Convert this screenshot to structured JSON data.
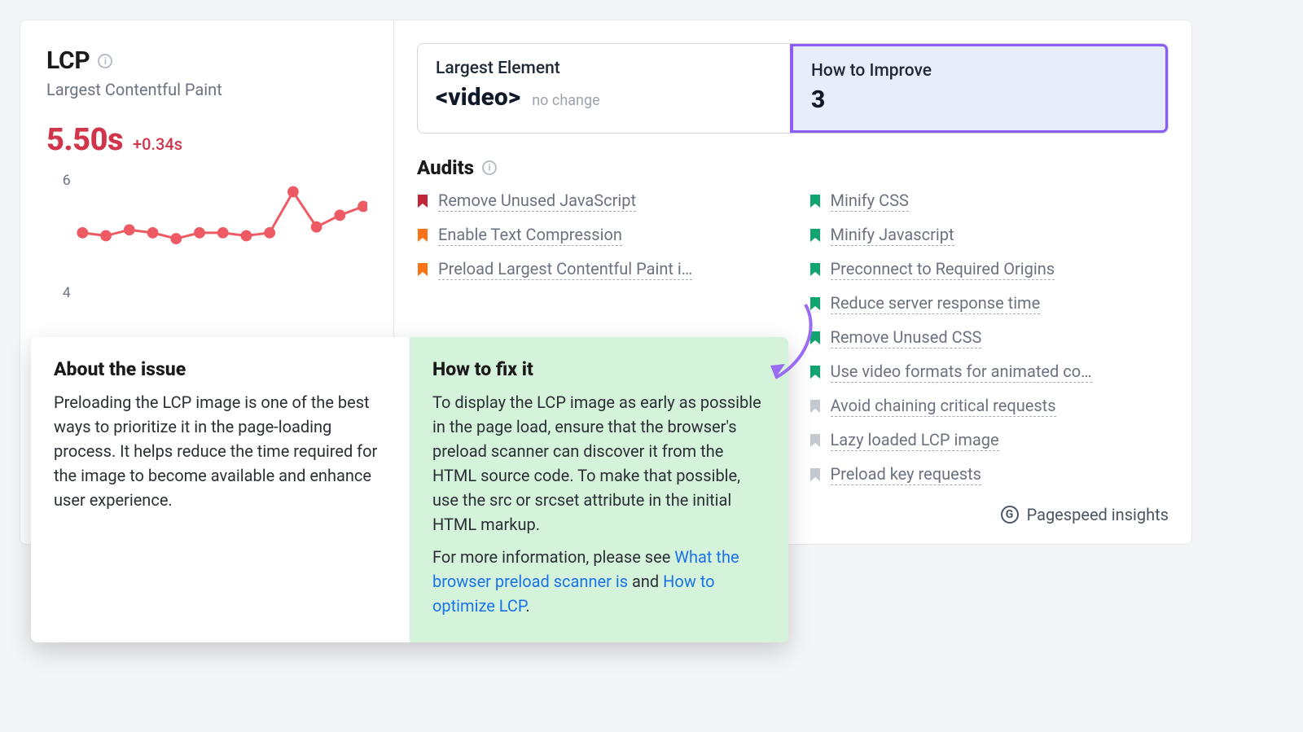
{
  "lcp": {
    "title": "LCP",
    "subtitle": "Largest Contentful Paint",
    "value": "5.50s",
    "delta": "+0.34s"
  },
  "chart_data": {
    "type": "line",
    "title": "",
    "xlabel": "",
    "ylabel": "",
    "ylim": [
      4,
      6
    ],
    "yticks": [
      4,
      6
    ],
    "x": [
      1,
      2,
      3,
      4,
      5,
      6,
      7,
      8,
      9,
      10,
      11,
      12,
      13
    ],
    "values": [
      5.1,
      5.05,
      5.15,
      5.1,
      5.0,
      5.1,
      5.1,
      5.05,
      5.1,
      5.8,
      5.2,
      5.4,
      5.55
    ],
    "color": "#ee5a63"
  },
  "cards": {
    "largest_element": {
      "label": "Largest Element",
      "value": "<video>",
      "sub": "no change"
    },
    "how_to_improve": {
      "label": "How to Improve",
      "value": "3"
    }
  },
  "audits": {
    "title": "Audits",
    "left": [
      {
        "label": "Remove Unused JavaScript",
        "color": "#c0263a"
      },
      {
        "label": "Enable Text Compression",
        "color": "#f97316"
      },
      {
        "label": "Preload Largest Contentful Paint i…",
        "color": "#f97316"
      }
    ],
    "right": [
      {
        "label": "Minify CSS",
        "color": "#10a56e"
      },
      {
        "label": "Minify Javascript",
        "color": "#10a56e"
      },
      {
        "label": "Preconnect to Required Origins",
        "color": "#10a56e"
      },
      {
        "label": "Reduce server response time",
        "color": "#10a56e"
      },
      {
        "label": "Remove Unused CSS",
        "color": "#10a56e"
      },
      {
        "label": "Use video formats for animated co…",
        "color": "#10a56e"
      },
      {
        "label": "Avoid chaining critical requests",
        "color": "#c4c8cf"
      },
      {
        "label": "Lazy loaded LCP image",
        "color": "#c4c8cf"
      },
      {
        "label": "Preload key requests",
        "color": "#c4c8cf"
      }
    ]
  },
  "footer": {
    "label": "Pagespeed insights"
  },
  "popover": {
    "about_title": "About the issue",
    "about_body": "Preloading the LCP image is one of the best ways to prioritize it in the page-loading process. It helps reduce the time required for the image to become available and enhance user experience.",
    "fix_title": "How to fix it",
    "fix_body_1": "To display the LCP image as early as possible in the page load, ensure that the browser's preload scanner can discover it from the HTML source code. To make that possible, use the src or srcset attribute in the initial HTML markup.",
    "fix_body_2a": "For more information, please see ",
    "fix_link_1": "What the browser preload scanner is",
    "fix_body_2b": " and ",
    "fix_link_2": "How to optimize LCP",
    "fix_body_2c": "."
  }
}
